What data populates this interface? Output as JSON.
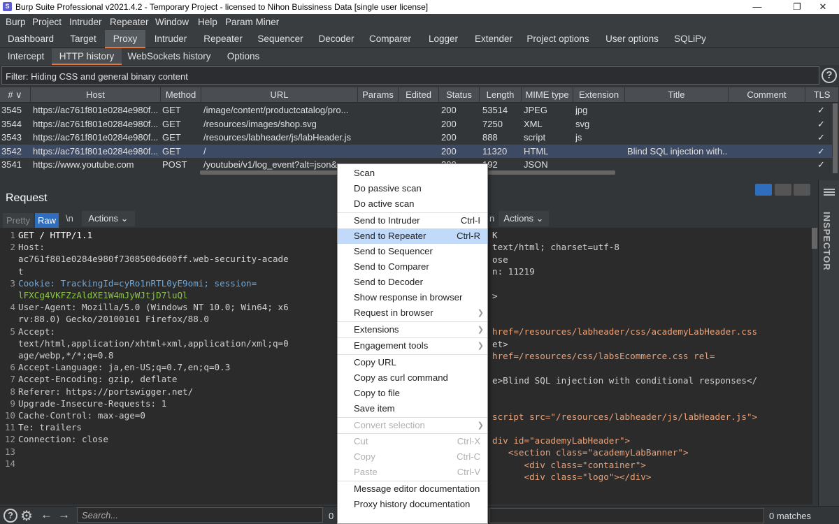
{
  "window": {
    "title": "Burp Suite Professional v2021.4.2 - Temporary Project - licensed to Nihon Buissiness Data [single user license]",
    "icon_glyph": "S"
  },
  "menu": [
    "Burp",
    "Project",
    "Intruder",
    "Repeater",
    "Window",
    "Help",
    "Param Miner"
  ],
  "main_tabs": [
    "Dashboard",
    "Target",
    "Proxy",
    "Intruder",
    "Repeater",
    "Sequencer",
    "Decoder",
    "Comparer",
    "Logger",
    "Extender",
    "Project options",
    "User options",
    "SQLiPy"
  ],
  "active_main_tab": "Proxy",
  "sub_tabs": [
    "Intercept",
    "HTTP history",
    "WebSockets history",
    "Options"
  ],
  "active_sub_tab": "HTTP history",
  "filter_text": "Filter: Hiding CSS and general binary content",
  "table": {
    "columns": [
      "# ∨",
      "Host",
      "Method",
      "URL",
      "Params",
      "Edited",
      "Status",
      "Length",
      "MIME type",
      "Extension",
      "Title",
      "Comment",
      "TLS"
    ],
    "rows": [
      {
        "num": "3545",
        "host": "https://ac761f801e0284e980f...",
        "method": "GET",
        "url": "/image/content/productcatalog/pro...",
        "status": "200",
        "length": "53514",
        "mime": "JPEG",
        "ext": "jpg",
        "title": "",
        "tls": "✓"
      },
      {
        "num": "3544",
        "host": "https://ac761f801e0284e980f...",
        "method": "GET",
        "url": "/resources/images/shop.svg",
        "status": "200",
        "length": "7250",
        "mime": "XML",
        "ext": "svg",
        "title": "",
        "tls": "✓"
      },
      {
        "num": "3543",
        "host": "https://ac761f801e0284e980f...",
        "method": "GET",
        "url": "/resources/labheader/js/labHeader.js",
        "status": "200",
        "length": "888",
        "mime": "script",
        "ext": "js",
        "title": "",
        "tls": "✓"
      },
      {
        "num": "3542",
        "host": "https://ac761f801e0284e980f...",
        "method": "GET",
        "url": "/",
        "status": "200",
        "length": "11320",
        "mime": "HTML",
        "ext": "",
        "title": "Blind SQL injection with...",
        "tls": "✓"
      },
      {
        "num": "3541",
        "host": "https://www.youtube.com",
        "method": "POST",
        "url": "/youtubei/v1/log_event?alt=json&",
        "status": "200",
        "length": "192",
        "mime": "JSON",
        "ext": "",
        "title": "",
        "tls": "✓"
      }
    ],
    "selected_row": "3542"
  },
  "request": {
    "title": "Request",
    "tabs": {
      "pretty": "Pretty",
      "raw": "Raw",
      "ln": "\\n",
      "actions": "Actions"
    },
    "lines": [
      {
        "n": "1",
        "text": "GET / HTTP/1.1"
      },
      {
        "n": "2",
        "text": "Host:"
      },
      {
        "n": "",
        "text": "ac761f801e0284e980f7308500d600ff.web-security-acade"
      },
      {
        "n": "",
        "text": "t"
      },
      {
        "n": "3",
        "text": "Cookie: TrackingId=cyRo1nRTL0yE9omi; session="
      },
      {
        "n": "",
        "text": "lFXCg4VKFZzAldXE1W4mJyWJtjD7luQl"
      },
      {
        "n": "4",
        "text": "User-Agent: Mozilla/5.0 (Windows NT 10.0; Win64; x6"
      },
      {
        "n": "",
        "text": "rv:88.0) Gecko/20100101 Firefox/88.0"
      },
      {
        "n": "5",
        "text": "Accept:"
      },
      {
        "n": "",
        "text": "text/html,application/xhtml+xml,application/xml;q=0"
      },
      {
        "n": "",
        "text": "age/webp,*/*;q=0.8"
      },
      {
        "n": "6",
        "text": "Accept-Language: ja,en-US;q=0.7,en;q=0.3"
      },
      {
        "n": "7",
        "text": "Accept-Encoding: gzip, deflate"
      },
      {
        "n": "8",
        "text": "Referer: https://portswigger.net/"
      },
      {
        "n": "9",
        "text": "Upgrade-Insecure-Requests: 1"
      },
      {
        "n": "10",
        "text": "Cache-Control: max-age=0"
      },
      {
        "n": "11",
        "text": "Te: trailers"
      },
      {
        "n": "12",
        "text": "Connection: close"
      },
      {
        "n": "13",
        "text": ""
      },
      {
        "n": "14",
        "text": ""
      }
    ]
  },
  "response": {
    "tab_n": "n",
    "actions": "Actions",
    "lines": [
      {
        "text": "K"
      },
      {
        "text": "text/html; charset=utf-8"
      },
      {
        "text": "ose"
      },
      {
        "text": "n: 11219"
      },
      {
        "text": ""
      },
      {
        "text": ">"
      },
      {
        "text": ""
      },
      {
        "text": ""
      },
      {
        "text": "href=/resources/labheader/css/academyLabHeader.css"
      },
      {
        "text": "et>"
      },
      {
        "text": "href=/resources/css/labsEcommerce.css rel="
      },
      {
        "text": ""
      },
      {
        "text": "e>Blind SQL injection with conditional responses</"
      },
      {
        "text": ""
      },
      {
        "text": ""
      },
      {
        "text": "script src=\"/resources/labheader/js/labHeader.js\">"
      },
      {
        "text": ""
      },
      {
        "text": "div id=\"academyLabHeader\">"
      },
      {
        "text": "   <section class=\"academyLabBanner\">"
      },
      {
        "text": "      <div class=\"container\">"
      },
      {
        "text": "      <div class=\"logo\"></div>"
      }
    ]
  },
  "inspector_label": "INSPECTOR",
  "statusbar": {
    "search_placeholder": "Search...",
    "left_count": "0",
    "matches": "0 matches"
  },
  "context_menu": {
    "items": [
      {
        "label": "Scan",
        "shortcut": "",
        "arrow": false,
        "disabled": false,
        "highlight": false,
        "sep_before": false
      },
      {
        "label": "Do passive scan",
        "shortcut": "",
        "arrow": false,
        "disabled": false,
        "highlight": false,
        "sep_before": false
      },
      {
        "label": "Do active scan",
        "shortcut": "",
        "arrow": false,
        "disabled": false,
        "highlight": false,
        "sep_before": false
      },
      {
        "label": "Send to Intruder",
        "shortcut": "Ctrl-I",
        "arrow": false,
        "disabled": false,
        "highlight": false,
        "sep_before": true
      },
      {
        "label": "Send to Repeater",
        "shortcut": "Ctrl-R",
        "arrow": false,
        "disabled": false,
        "highlight": true,
        "sep_before": false
      },
      {
        "label": "Send to Sequencer",
        "shortcut": "",
        "arrow": false,
        "disabled": false,
        "highlight": false,
        "sep_before": false
      },
      {
        "label": "Send to Comparer",
        "shortcut": "",
        "arrow": false,
        "disabled": false,
        "highlight": false,
        "sep_before": false
      },
      {
        "label": "Send to Decoder",
        "shortcut": "",
        "arrow": false,
        "disabled": false,
        "highlight": false,
        "sep_before": false
      },
      {
        "label": "Show response in browser",
        "shortcut": "",
        "arrow": false,
        "disabled": false,
        "highlight": false,
        "sep_before": false
      },
      {
        "label": "Request in browser",
        "shortcut": "",
        "arrow": true,
        "disabled": false,
        "highlight": false,
        "sep_before": false
      },
      {
        "label": "Extensions",
        "shortcut": "",
        "arrow": true,
        "disabled": false,
        "highlight": false,
        "sep_before": true
      },
      {
        "label": "Engagement tools",
        "shortcut": "",
        "arrow": true,
        "disabled": false,
        "highlight": false,
        "sep_before": true
      },
      {
        "label": "Copy URL",
        "shortcut": "",
        "arrow": false,
        "disabled": false,
        "highlight": false,
        "sep_before": true
      },
      {
        "label": "Copy as curl command",
        "shortcut": "",
        "arrow": false,
        "disabled": false,
        "highlight": false,
        "sep_before": false
      },
      {
        "label": "Copy to file",
        "shortcut": "",
        "arrow": false,
        "disabled": false,
        "highlight": false,
        "sep_before": false
      },
      {
        "label": "Save item",
        "shortcut": "",
        "arrow": false,
        "disabled": false,
        "highlight": false,
        "sep_before": false
      },
      {
        "label": "Convert selection",
        "shortcut": "",
        "arrow": true,
        "disabled": true,
        "highlight": false,
        "sep_before": true
      },
      {
        "label": "Cut",
        "shortcut": "Ctrl-X",
        "arrow": false,
        "disabled": true,
        "highlight": false,
        "sep_before": true
      },
      {
        "label": "Copy",
        "shortcut": "Ctrl-C",
        "arrow": false,
        "disabled": true,
        "highlight": false,
        "sep_before": false
      },
      {
        "label": "Paste",
        "shortcut": "Ctrl-V",
        "arrow": false,
        "disabled": true,
        "highlight": false,
        "sep_before": false
      },
      {
        "label": "Message editor documentation",
        "shortcut": "",
        "arrow": false,
        "disabled": false,
        "highlight": false,
        "sep_before": true
      },
      {
        "label": "Proxy history documentation",
        "shortcut": "",
        "arrow": false,
        "disabled": false,
        "highlight": false,
        "sep_before": false
      }
    ]
  },
  "colors": {
    "accent": "#e8763a",
    "selected_row": "#3d4a63",
    "raw_tab": "#2f6dbf",
    "menu_highlight": "#c2dafa"
  }
}
